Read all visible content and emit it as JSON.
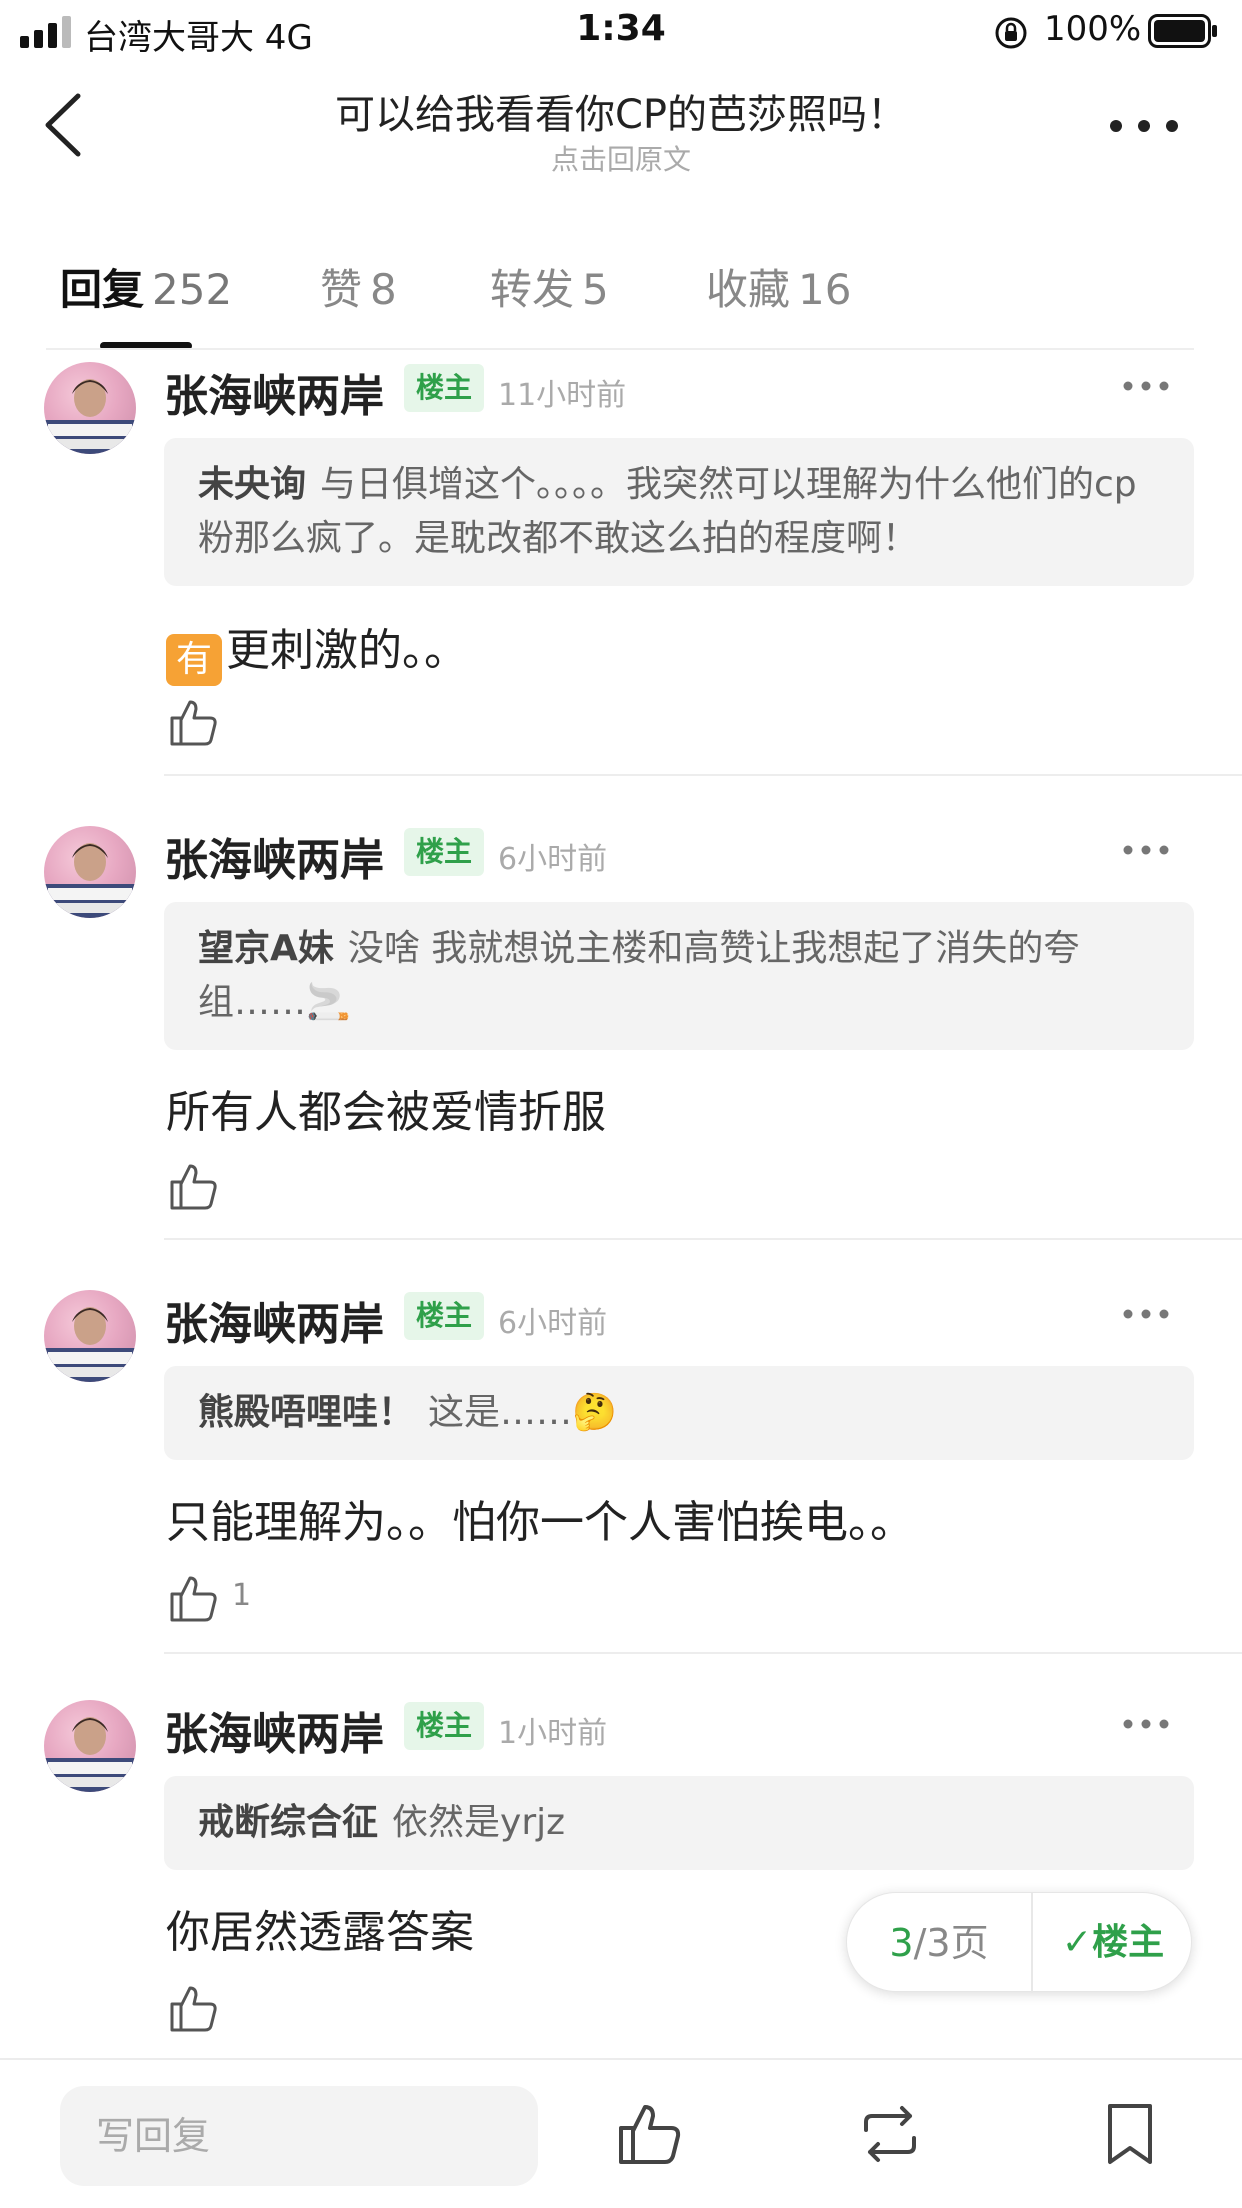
{
  "status_bar": {
    "carrier": "台湾大哥大  4G",
    "time": "1:34",
    "battery": "100%"
  },
  "nav": {
    "title": "可以给我看看你CP的芭莎照吗！",
    "subtitle": "点击回原文"
  },
  "tabs": [
    {
      "label": "回复",
      "count": "252"
    },
    {
      "label": "赞",
      "count": "8"
    },
    {
      "label": "转发",
      "count": "5"
    },
    {
      "label": "收藏",
      "count": "16"
    }
  ],
  "replies": [
    {
      "username": "张海峡两岸",
      "badge": "楼主",
      "time": "11小时前",
      "quote_user": "未央询",
      "quote_text": "与日俱增这个。。。。我突然可以理解为什么他们的cp粉那么疯了。是耽改都不敢这么拍的程度啊！",
      "emoji": "有",
      "content": "更刺激的。。",
      "likes": ""
    },
    {
      "username": "张海峡两岸",
      "badge": "楼主",
      "time": "6小时前",
      "quote_user": "望京A妹",
      "quote_text": "没啥 我就想说主楼和高赞让我想起了消失的夸组……🚬",
      "content": "所有人都会被爱情折服",
      "likes": ""
    },
    {
      "username": "张海峡两岸",
      "badge": "楼主",
      "time": "6小时前",
      "quote_user": "熊殿唔哩哇！",
      "quote_text": "这是……🤔",
      "content": "只能理解为。。怕你一个人害怕挨电。。",
      "likes": "1"
    },
    {
      "username": "张海峡两岸",
      "badge": "楼主",
      "time": "1小时前",
      "quote_user": "戒断综合征",
      "quote_text": "依然是yrjz",
      "content": "你居然透露答案",
      "likes": ""
    }
  ],
  "pager": {
    "current": "3",
    "total": "/3页",
    "op_filter": "✓楼主"
  },
  "bottom_bar": {
    "reply_placeholder": "写回复"
  },
  "colors": {
    "accent_green": "#2fa04a",
    "badge_bg": "#e6f6e9",
    "quote_bg": "#f3f3f3"
  },
  "icons": [
    "back-chevron-icon",
    "more-dots-icon",
    "thumb-up-icon",
    "share-icon",
    "bookmark-icon"
  ]
}
